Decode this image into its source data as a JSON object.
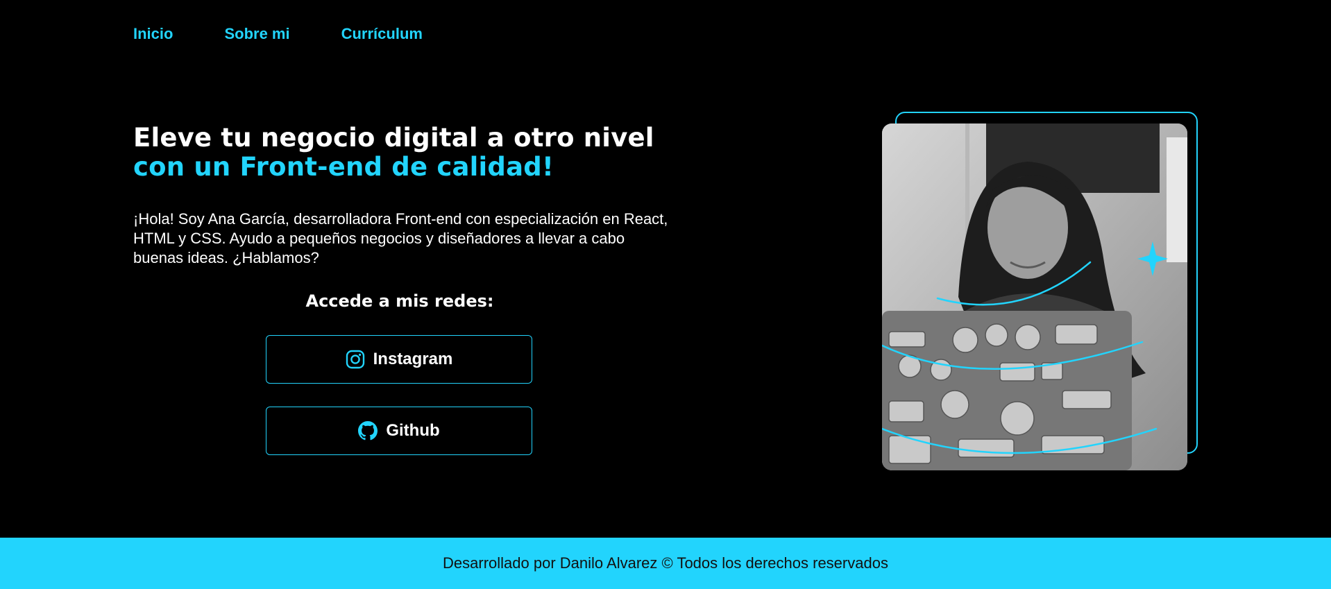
{
  "nav": {
    "items": [
      {
        "label": "Inicio"
      },
      {
        "label": "Sobre mi"
      },
      {
        "label": "Currículum"
      }
    ]
  },
  "hero": {
    "title_line1": "Eleve tu negocio digital a otro nivel",
    "title_line2": "con un Front-end de calidad!",
    "intro": "¡Hola! Soy Ana García, desarrolladora Front-end con especialización en React, HTML y CSS. Ayudo a pequeños negocios y diseñadores a llevar a cabo buenas ideas. ¿Hablamos?"
  },
  "social": {
    "heading": "Accede a mis redes:",
    "buttons": [
      {
        "label": "Instagram",
        "icon": "instagram-icon"
      },
      {
        "label": "Github",
        "icon": "github-icon"
      }
    ]
  },
  "footer": {
    "text": "Desarrollado por Danilo Alvarez © Todos los derechos reservados"
  },
  "colors": {
    "accent": "#22d4fd",
    "background": "#000000",
    "text": "#ffffff"
  }
}
